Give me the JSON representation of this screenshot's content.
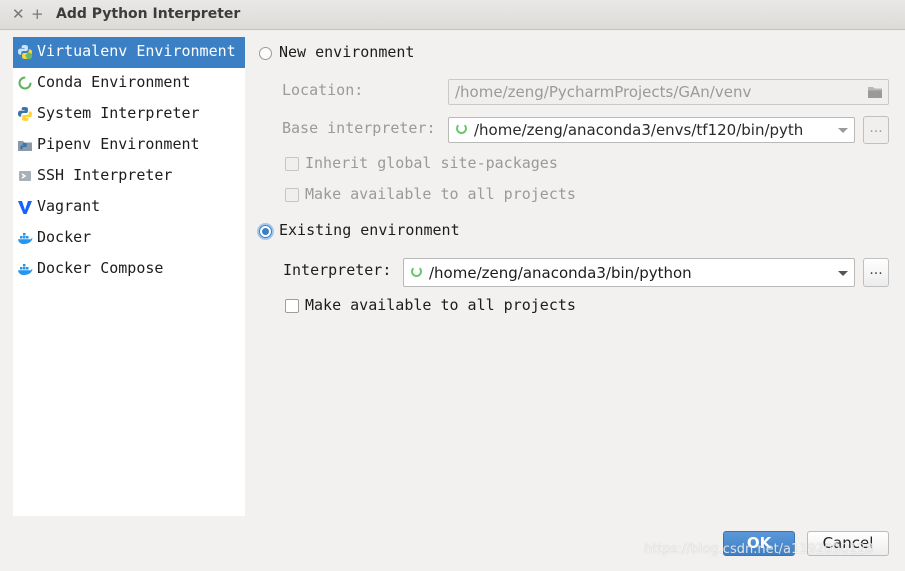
{
  "window": {
    "title": "Add Python Interpreter",
    "close_glyph": "✕",
    "add_glyph": "+"
  },
  "sidebar": {
    "items": [
      {
        "label": "Virtualenv Environment",
        "icon": "python-venv-icon",
        "selected": true
      },
      {
        "label": "Conda Environment",
        "icon": "conda-icon",
        "selected": false
      },
      {
        "label": "System Interpreter",
        "icon": "python-icon",
        "selected": false
      },
      {
        "label": "Pipenv Environment",
        "icon": "pipenv-icon",
        "selected": false
      },
      {
        "label": "SSH Interpreter",
        "icon": "ssh-icon",
        "selected": false
      },
      {
        "label": "Vagrant",
        "icon": "vagrant-icon",
        "selected": false
      },
      {
        "label": "Docker",
        "icon": "docker-icon",
        "selected": false
      },
      {
        "label": "Docker Compose",
        "icon": "docker-compose-icon",
        "selected": false
      }
    ]
  },
  "new_env": {
    "label": "New environment",
    "selected": false,
    "location_label": "Location:",
    "location_value": "/home/zeng/PycharmProjects/GAn/venv",
    "base_label": "Base interpreter:",
    "base_value": "/home/zeng/anaconda3/envs/tf120/bin/pyth",
    "browse": "...",
    "inherit_label": "Inherit global site-packages",
    "available_label": "Make available to all projects"
  },
  "existing_env": {
    "label": "Existing environment",
    "selected": true,
    "interpreter_label": "Interpreter:",
    "interpreter_value": "/home/zeng/anaconda3/bin/python",
    "browse": "...",
    "available_label": "Make available to all projects"
  },
  "buttons": {
    "ok": "OK",
    "cancel": "Cancel"
  },
  "watermark": "https://blog.csdn.net/a1192090128",
  "colors": {
    "accent": "#3b7fc4",
    "background": "#f2f1f0",
    "sidebar_bg": "#ffffff"
  }
}
